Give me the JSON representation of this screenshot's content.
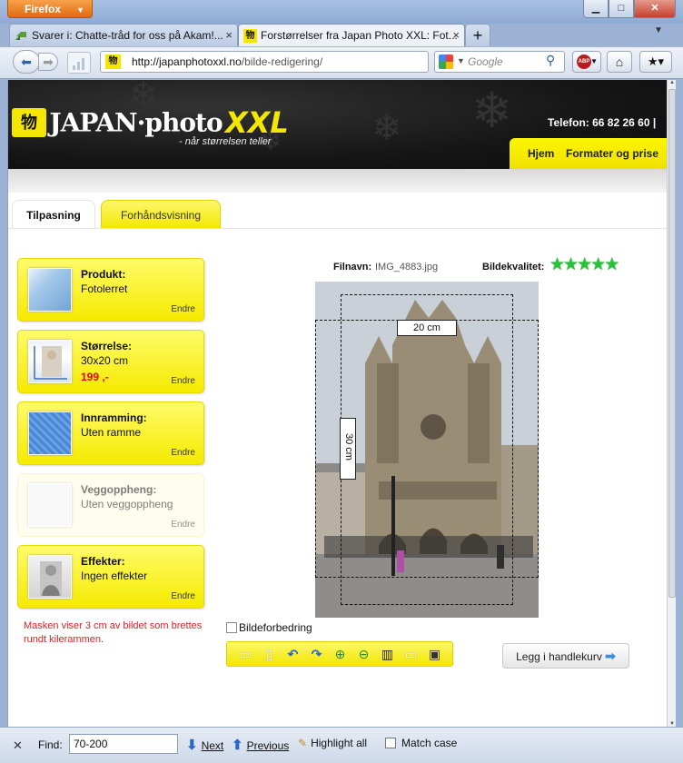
{
  "browser": {
    "app_button": "Firefox",
    "tabs": [
      {
        "title": "Svarer i: Chatte-tråd for oss på Akam!...",
        "active": false
      },
      {
        "title": "Forstørrelser fra Japan Photo XXL: Fot...",
        "active": true
      }
    ],
    "url_host": "http://japanphotoxxl.no",
    "url_path": "/bilde-redigering/",
    "search_placeholder": "Google"
  },
  "site": {
    "logo_mark": "物",
    "logo_text": "JAPAN·photo",
    "logo_xxl": "XXL",
    "tagline": "- når størrelsen teller",
    "phone": "Telefon: 66 82 26 60 |",
    "nav": [
      "Hjem",
      "Formater og prise"
    ]
  },
  "editor_tabs": [
    "Tilpasning",
    "Forhåndsvisning"
  ],
  "steps": [
    {
      "title": "Produkt:",
      "value": "Fotolerret",
      "change": "Endre"
    },
    {
      "title": "Størrelse:",
      "value": "30x20 cm",
      "price": "199 ,-",
      "change": "Endre"
    },
    {
      "title": "Innramming:",
      "value": "Uten ramme",
      "change": "Endre"
    },
    {
      "title": "Veggoppheng:",
      "value": "Uten veggoppheng",
      "change": "Endre"
    },
    {
      "title": "Effekter:",
      "value": "Ingen effekter",
      "change": "Endre"
    }
  ],
  "mask_note": "Masken viser 3 cm av bildet som brettes rundt kilerammen.",
  "image": {
    "filename_label": "Filnavn:",
    "filename": "IMG_4883.jpg",
    "quality_label": "Bildekvalitet:",
    "quality_stars": 5,
    "width_label": "20 cm",
    "height_label": "30 cm"
  },
  "enhance_label": "Bildeforbedring",
  "cart_button": "Legg i handlekurv",
  "findbar": {
    "label": "Find:",
    "query": "70-200",
    "next": "Next",
    "previous": "Previous",
    "highlight_all": "Highlight all",
    "match_case": "Match case"
  },
  "colors": {
    "brand_yellow": "#f5ea00",
    "accent_red": "#e00000",
    "star_green": "#29c33b"
  }
}
